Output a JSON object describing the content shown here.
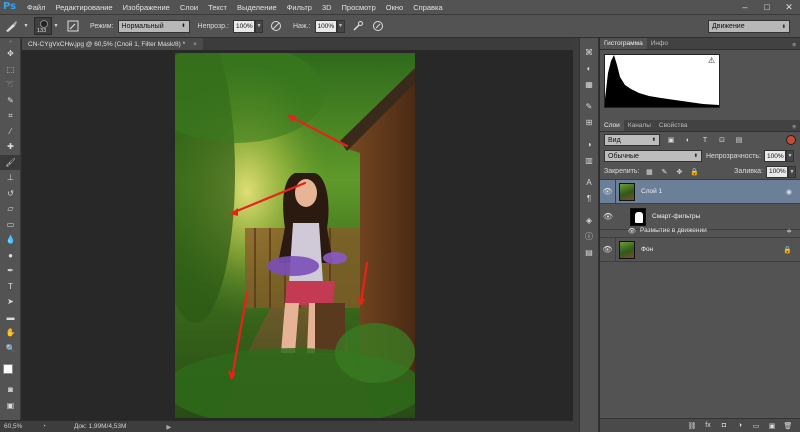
{
  "app": {
    "logo": "Ps"
  },
  "menu": [
    "Файл",
    "Редактирование",
    "Изображение",
    "Слои",
    "Текст",
    "Выделение",
    "Фильтр",
    "3D",
    "Просмотр",
    "Окно",
    "Справка"
  ],
  "window_controls": {
    "minimize": "–",
    "maximize": "□",
    "close": "✕"
  },
  "options": {
    "brush_size": "133",
    "mode_label": "Режим:",
    "mode_value": "Нормальный",
    "opacity_label": "Непрозр.:",
    "opacity_value": "100%",
    "pressure_label": "Наж.:",
    "pressure_value": "100%",
    "workspace": "Движение"
  },
  "document": {
    "tab_title": "CN-CYgVxCHw.jpg @ 60,5% (Слой 1, Filter Mask/8) *",
    "tab_close": "×",
    "zoom": "60,5%",
    "doc_info": "Док: 1,99М/4,53М"
  },
  "histogram_panel": {
    "tabs": [
      "Гистограмма",
      "Инфо"
    ],
    "warning": "⚠"
  },
  "layers_panel": {
    "tabs": [
      "Слои",
      "Каналы",
      "Свойства"
    ],
    "kind_filter": "Вид",
    "blend_mode": "Обычные",
    "opacity_label": "Непрозрачность:",
    "opacity_value": "100%",
    "lock_label": "Закрепить:",
    "fill_label": "Заливка:",
    "fill_value": "100%",
    "layers": [
      {
        "name": "Слой 1",
        "selected": true
      },
      {
        "name": "Фон",
        "selected": false
      }
    ],
    "smart_filters_label": "Смарт-фильтры",
    "filter_name": "Размытие в движении"
  },
  "colors": {
    "accent_selected": "#6b7f98",
    "arrow_red": "#e8221b",
    "ps_blue": "#2fa3f5"
  }
}
